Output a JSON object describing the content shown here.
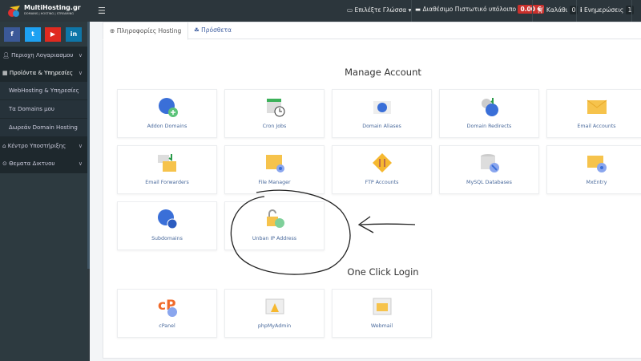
{
  "header": {
    "logo_text": "MultiHosting.gr",
    "logo_tagline": "DOMAINS | HOSTING | STREAMING",
    "language_label": "Επιλέξτε Γλώσσα",
    "credit_label": "Διαθέσιμο Πιστωτικό υπόλοιπο",
    "credit_value": "0.00 €",
    "cart_label": "Καλάθι",
    "cart_count": "0",
    "updates_label": "Ενημερώσεις",
    "updates_count": "1"
  },
  "social": [
    {
      "icon": "facebook-icon",
      "glyph": "f",
      "color": "#3b5998"
    },
    {
      "icon": "twitter-icon",
      "glyph": "t",
      "color": "#1da1f2"
    },
    {
      "icon": "youtube-icon",
      "glyph": "▶",
      "color": "#e02a20"
    },
    {
      "icon": "linkedin-icon",
      "glyph": "in",
      "color": "#0e76a8"
    }
  ],
  "sidebar": {
    "items": [
      {
        "label": "Περιοχη Λογαριασμου",
        "icon": "user-icon"
      },
      {
        "label": "Προϊόντα & Υπηρεσίες",
        "icon": "grid-icon"
      },
      {
        "label": "WebHosting & Υπηρεσίες"
      },
      {
        "label": "Τα Domains μου"
      },
      {
        "label": "Δωρεάν Domain Hosting"
      },
      {
        "label": "Κέντρο Υποστήριξης",
        "icon": "home-icon"
      },
      {
        "label": "Θεματα Δικτυου",
        "icon": "globe-icon"
      }
    ]
  },
  "tabs": [
    {
      "label": "Πληροφορίες Hosting",
      "icon": "globe-icon",
      "active": true
    },
    {
      "label": "Πρόσθετα",
      "icon": "cubes-icon",
      "active": false
    }
  ],
  "manage_account": {
    "title": "Manage Account",
    "items": [
      {
        "label": "Addon Domains",
        "icon": "globe-plus-icon"
      },
      {
        "label": "Cron Jobs",
        "icon": "calendar-clock-icon"
      },
      {
        "label": "Domain Aliases",
        "icon": "domain-alias-icon"
      },
      {
        "label": "Domain Redirects",
        "icon": "globe-redirect-icon"
      },
      {
        "label": "Email Accounts",
        "icon": "envelope-icon"
      },
      {
        "label": "Email Forwarders",
        "icon": "email-forward-icon"
      },
      {
        "label": "File Manager",
        "icon": "folder-gear-icon"
      },
      {
        "label": "FTP Accounts",
        "icon": "ftp-arrows-icon"
      },
      {
        "label": "MySQL Databases",
        "icon": "database-icon"
      },
      {
        "label": "MxEntry",
        "icon": "envelope-gear-icon"
      },
      {
        "label": "Subdomains",
        "icon": "globe-sub-icon"
      },
      {
        "label": "Unban IP Address",
        "icon": "unlock-ip-icon"
      }
    ]
  },
  "one_click_login": {
    "title": "One Click Login",
    "items": [
      {
        "label": "cPanel",
        "icon": "cpanel-icon"
      },
      {
        "label": "phpMyAdmin",
        "icon": "phpmyadmin-icon"
      },
      {
        "label": "Webmail",
        "icon": "webmail-icon"
      }
    ]
  }
}
